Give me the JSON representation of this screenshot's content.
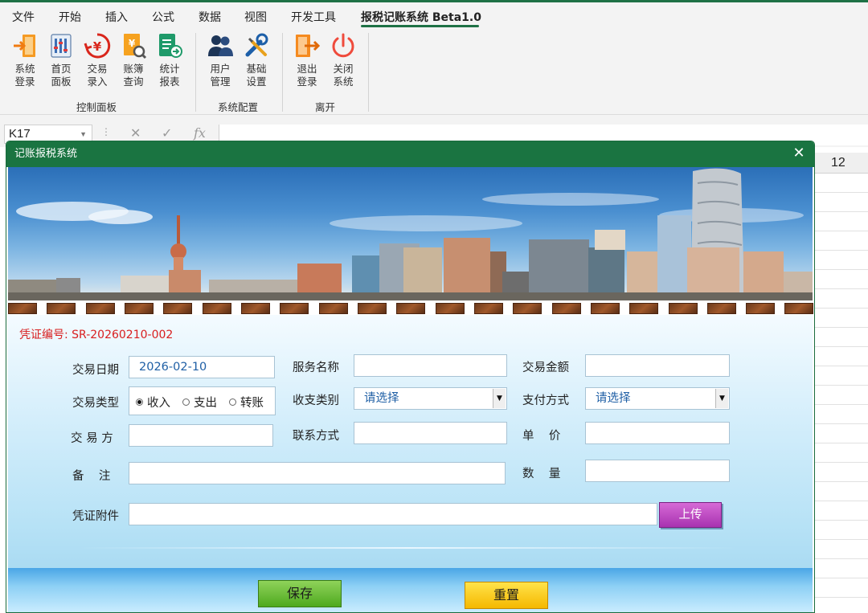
{
  "menubar": {
    "items": [
      "文件",
      "开始",
      "插入",
      "公式",
      "数据",
      "视图",
      "开发工具",
      "报税记账系统 Beta1.0"
    ]
  },
  "ribbon": {
    "buttons": [
      "系统\n登录",
      "首页\n面板",
      "交易\n录入",
      "账簿\n查询",
      "统计\n报表",
      "用户\n管理",
      "基础\n设置",
      "退出\n登录",
      "关闭\n系统"
    ],
    "groups": [
      "控制面板",
      "系统配置",
      "离开"
    ]
  },
  "formula_bar": {
    "name_box": "K17",
    "cancel_symbol": "✕",
    "enter_symbol": "✓",
    "fx_symbol": "fx"
  },
  "sheet": {
    "column_header": "12"
  },
  "dialog": {
    "title": "记账报税系统",
    "voucher": "凭证编号: SR-20260210-002",
    "labels": {
      "date": "交易日期",
      "type": "交易类型",
      "party": "交 易 方",
      "note": "备    注",
      "service": "服务名称",
      "category": "收支类别",
      "contact": "联系方式",
      "amount": "交易金额",
      "payment": "支付方式",
      "unit_price": "单    价",
      "quantity": "数    量",
      "attachment": "凭证附件"
    },
    "values": {
      "date": "2026-02-10",
      "category": "请选择",
      "payment": "请选择"
    },
    "radio": [
      "收入",
      "支出",
      "转账"
    ],
    "buttons": {
      "upload": "上传",
      "save": "保存",
      "reset": "重置"
    }
  },
  "colors": {
    "excel_green": "#1a7441",
    "voucher_red": "#d81e1e",
    "upload_purple": "#b23ab8",
    "save_green": "#5fb82c",
    "reset_yellow": "#f8c800"
  }
}
